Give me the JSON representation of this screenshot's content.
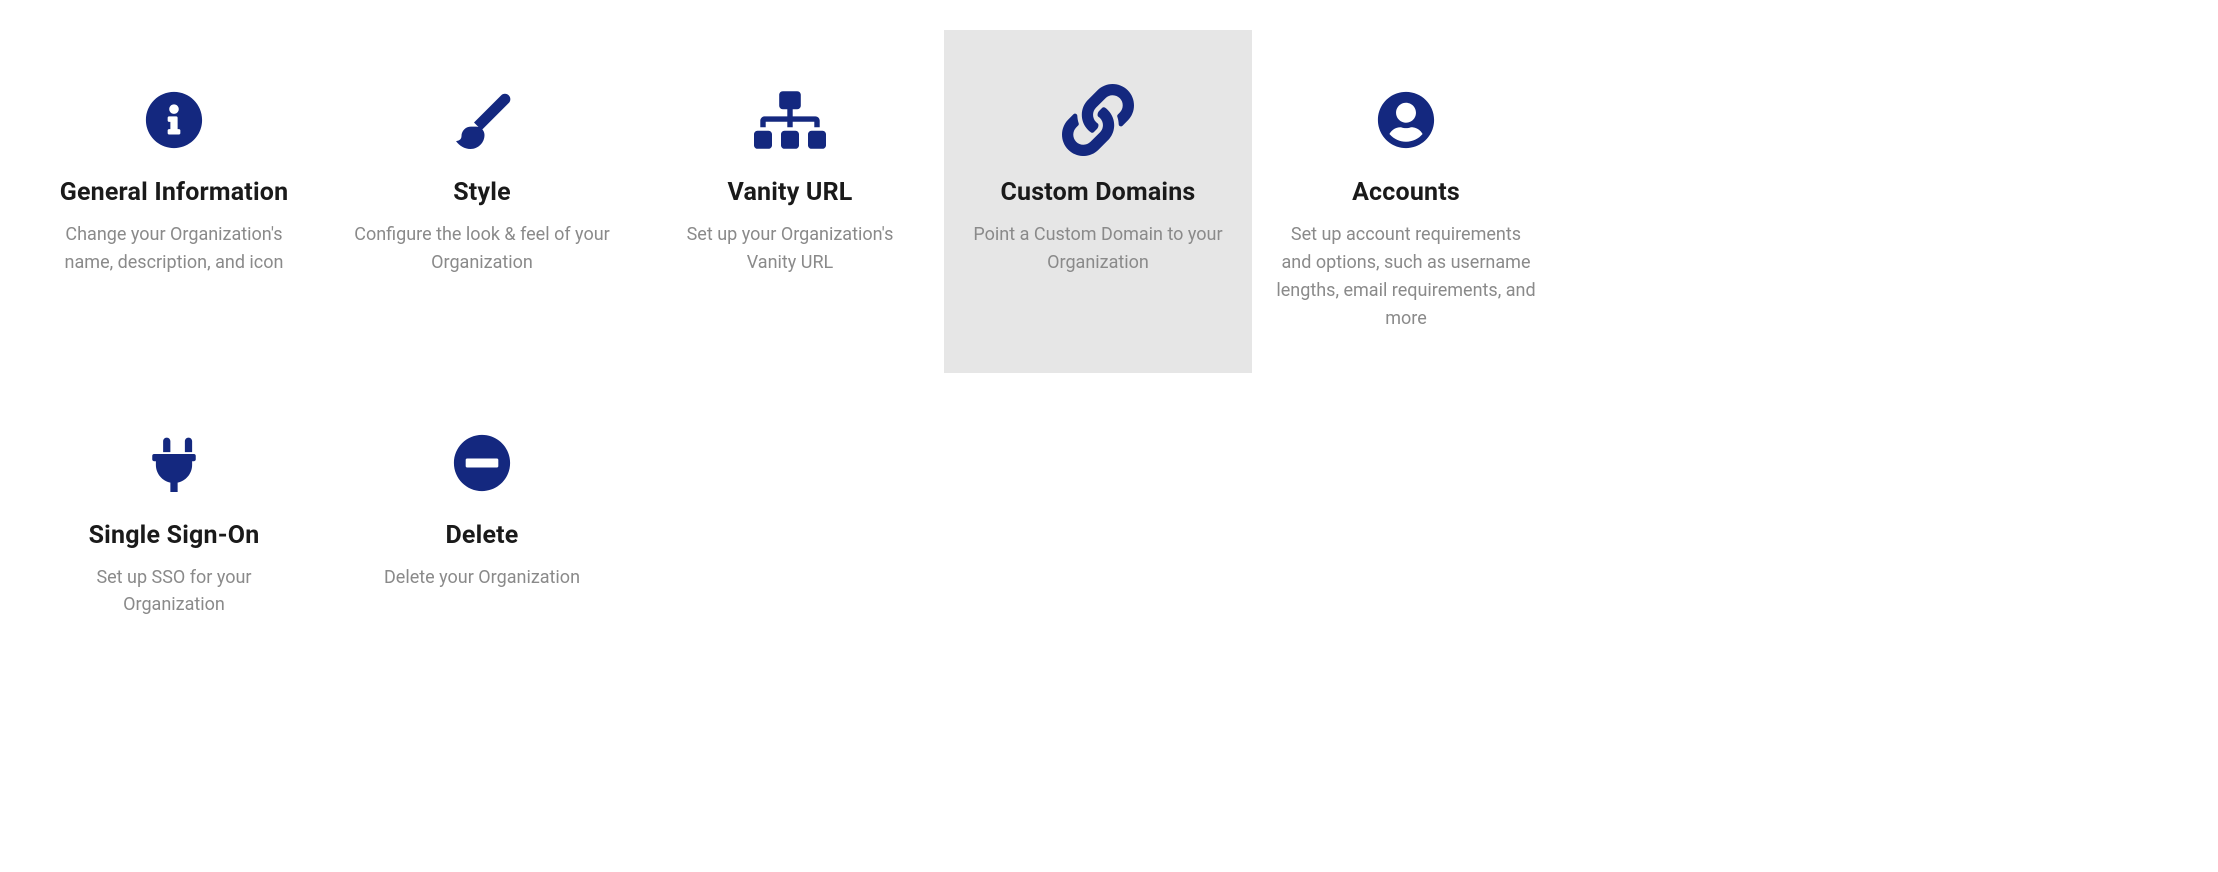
{
  "colors": {
    "accent": "#14287f"
  },
  "cards": [
    {
      "title": "General Information",
      "desc": "Change your Organization's name, description, and icon"
    },
    {
      "title": "Style",
      "desc": "Configure the look & feel of your Organization"
    },
    {
      "title": "Vanity URL",
      "desc": "Set up your Organization's Vanity URL"
    },
    {
      "title": "Custom Domains",
      "desc": "Point a Custom Domain to your Organization"
    },
    {
      "title": "Accounts",
      "desc": "Set up account requirements and options, such as username lengths, email requirements, and more"
    },
    {
      "title": "Single Sign-On",
      "desc": "Set up SSO for your Organization"
    },
    {
      "title": "Delete",
      "desc": "Delete your Organization"
    }
  ]
}
